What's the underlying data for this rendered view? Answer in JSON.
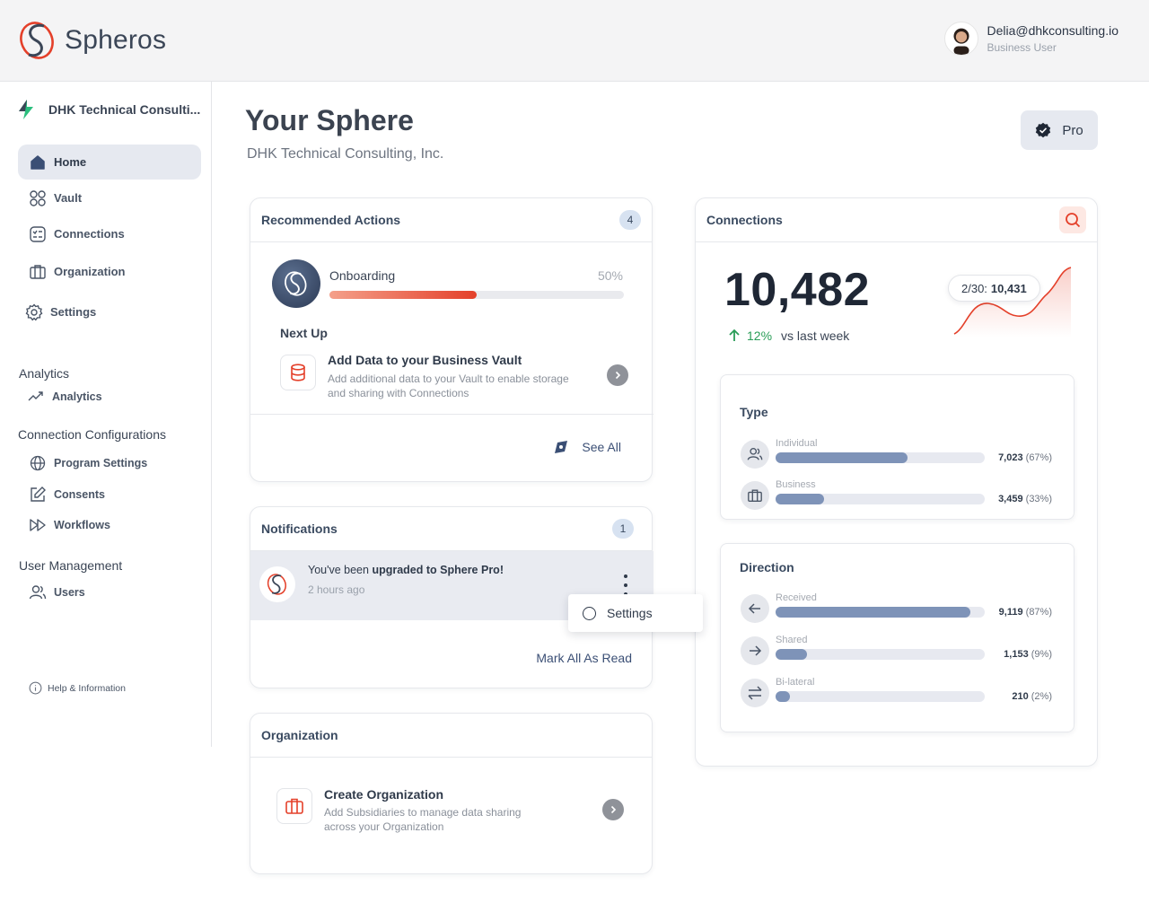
{
  "brand": {
    "name": "Spheros",
    "accent": "#e4402a",
    "navy": "#3b4f75"
  },
  "user": {
    "email": "Delia@dhkconsulting.io",
    "role": "Business User"
  },
  "sidebar": {
    "org_name": "DHK Technical Consulti...",
    "main_items": [
      {
        "label": "Home",
        "icon": "home-icon",
        "active": true
      },
      {
        "label": "Vault",
        "icon": "grid-icon",
        "active": false
      },
      {
        "label": "Connections",
        "icon": "connections-icon",
        "active": false
      },
      {
        "label": "Organization",
        "icon": "building-icon",
        "active": false
      },
      {
        "label": "Settings",
        "icon": "gear-icon",
        "active": false
      }
    ],
    "analytics": {
      "title": "Analytics",
      "items": [
        {
          "label": "Analytics",
          "icon": "trend-icon"
        }
      ]
    },
    "config": {
      "title": "Connection Configurations",
      "items": [
        {
          "label": "Program Settings",
          "icon": "globe-icon"
        },
        {
          "label": "Consents",
          "icon": "edit-icon"
        },
        {
          "label": "Workflows",
          "icon": "fast-forward-icon"
        }
      ]
    },
    "users": {
      "title": "User Management",
      "items": [
        {
          "label": "Users",
          "icon": "users-icon"
        }
      ]
    },
    "help": "Help & Information"
  },
  "header": {
    "title": "Your Sphere",
    "subtitle": "DHK Technical Consulting, Inc.",
    "plan_label": "Pro"
  },
  "recommended": {
    "title": "Recommended Actions",
    "count": "4",
    "onboarding_label": "Onboarding",
    "onboarding_pct_text": "50%",
    "onboarding_progress": 0.5,
    "next_up": "Next Up",
    "task_title": "Add Data to your Business Vault",
    "task_desc": "Add additional data to your Vault to enable storage and sharing with Connections",
    "see_all": "See All"
  },
  "notifications": {
    "title": "Notifications",
    "count": "1",
    "msg_prefix": "You've been ",
    "msg_bold": "upgraded to Sphere Pro!",
    "time": "2 hours ago",
    "mark_read": "Mark All As Read",
    "menu_item": "Settings"
  },
  "organization": {
    "title": "Organization",
    "task_title": "Create Organization",
    "task_desc": "Add Subsidiaries to manage data sharing across your Organization"
  },
  "connections": {
    "title": "Connections",
    "total": "10,482",
    "trend_pct": "12%",
    "trend_text": "vs last week",
    "tooltip_date": "2/30:",
    "tooltip_value": "10,431",
    "type": {
      "title": "Type",
      "rows": [
        {
          "label": "Individual",
          "value": "7,023",
          "pct": "(67%)",
          "fraction": 0.63,
          "icon": "users-icon"
        },
        {
          "label": "Business",
          "value": "3,459",
          "pct": "(33%)",
          "fraction": 0.23,
          "icon": "briefcase-icon"
        }
      ]
    },
    "direction": {
      "title": "Direction",
      "rows": [
        {
          "label": "Received",
          "value": "9,119",
          "pct": "(87%)",
          "fraction": 0.93,
          "icon": "arrow-left-icon"
        },
        {
          "label": "Shared",
          "value": "1,153",
          "pct": "(9%)",
          "fraction": 0.15,
          "icon": "arrow-right-icon"
        },
        {
          "label": "Bi-lateral",
          "value": "210",
          "pct": "(2%)",
          "fraction": 0.07,
          "icon": "swap-icon"
        }
      ]
    }
  }
}
